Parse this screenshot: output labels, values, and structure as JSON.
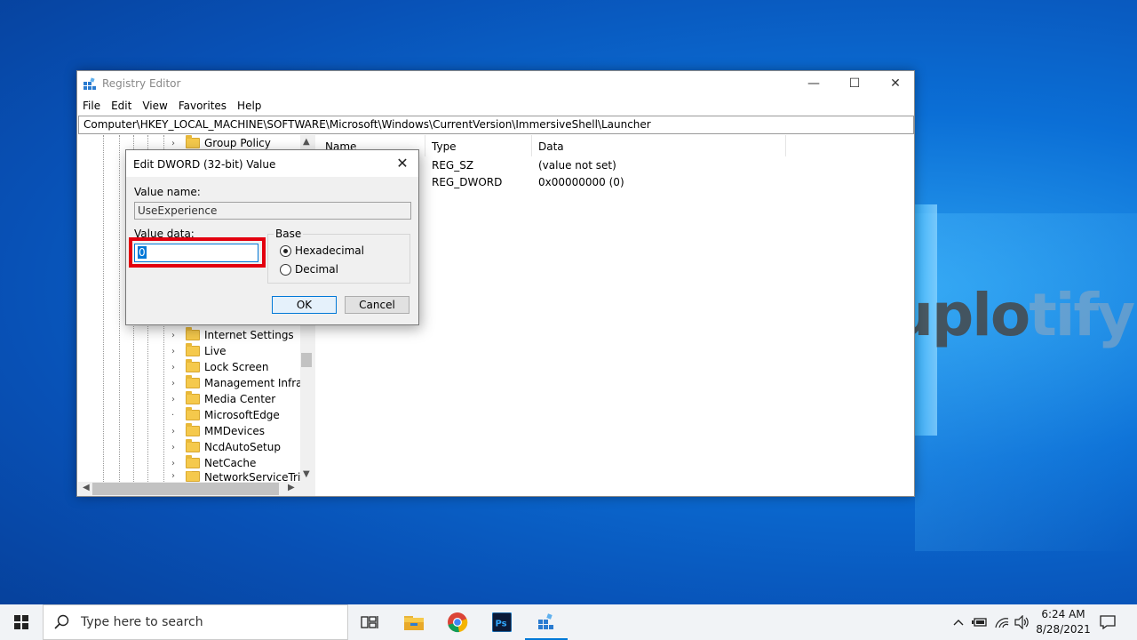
{
  "watermark": {
    "part1": "uplo",
    "part2": "tify"
  },
  "window": {
    "title": "Registry Editor",
    "controls": {
      "minimize": "—",
      "maximize": "☐",
      "close": "✕"
    },
    "menu": [
      "File",
      "Edit",
      "View",
      "Favorites",
      "Help"
    ],
    "address": "Computer\\HKEY_LOCAL_MACHINE\\SOFTWARE\\Microsoft\\Windows\\CurrentVersion\\ImmersiveShell\\Launcher",
    "tree": [
      {
        "label": "Group Policy",
        "expandable": true
      },
      {
        "label": "Internet Settings",
        "expandable": true
      },
      {
        "label": "Live",
        "expandable": true
      },
      {
        "label": "Lock Screen",
        "expandable": true
      },
      {
        "label": "Management Infrastr",
        "expandable": true
      },
      {
        "label": "Media Center",
        "expandable": true
      },
      {
        "label": "MicrosoftEdge",
        "expandable": false
      },
      {
        "label": "MMDevices",
        "expandable": true
      },
      {
        "label": "NcdAutoSetup",
        "expandable": true
      },
      {
        "label": "NetCache",
        "expandable": true
      },
      {
        "label": "NetworkServiceTrigge",
        "expandable": true
      }
    ],
    "columns": {
      "name": "Name",
      "type": "Type",
      "data": "Data"
    },
    "values": [
      {
        "name": "",
        "type": "REG_SZ",
        "data": "(value not set)"
      },
      {
        "name": "",
        "type": "REG_DWORD",
        "data": "0x00000000 (0)"
      }
    ]
  },
  "dialog": {
    "title": "Edit DWORD (32-bit) Value",
    "close": "✕",
    "value_name_label": "Value name:",
    "value_name": "UseExperience",
    "value_data_label": "Value data:",
    "value_data": "0",
    "base_label": "Base",
    "base_options": [
      {
        "label": "Hexadecimal",
        "selected": true
      },
      {
        "label": "Decimal",
        "selected": false
      }
    ],
    "ok": "OK",
    "cancel": "Cancel"
  },
  "taskbar": {
    "search_placeholder": "Type here to search",
    "time": "6:24 AM",
    "date": "8/28/2021",
    "apps": [
      "task-view-icon",
      "file-explorer-icon",
      "chrome-icon",
      "photoshop-icon",
      "registry-editor-icon"
    ],
    "active_app": "registry-editor-icon",
    "photoshop_text": "Ps"
  }
}
